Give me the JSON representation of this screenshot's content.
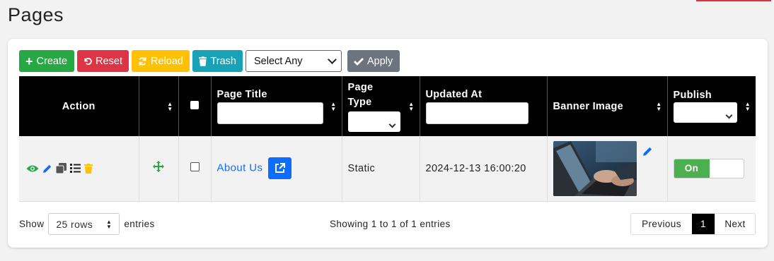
{
  "page": {
    "title": "Pages"
  },
  "toolbar": {
    "create_label": "Create",
    "reset_label": "Reset",
    "reload_label": "Reload",
    "trash_label": "Trash",
    "bulk_select_value": "Select Any",
    "apply_label": "Apply"
  },
  "table": {
    "headers": {
      "action": "Action",
      "page_title": "Page Title",
      "page_type": "Page Type",
      "updated_at": "Updated At",
      "banner_image": "Banner Image",
      "publish": "Publish"
    },
    "rows": [
      {
        "page_title": "About Us",
        "page_type": "Static",
        "updated_at": "2024-12-13 16:00:20",
        "banner_alt": "laptop-typing-photo",
        "publish": "On"
      }
    ]
  },
  "footer": {
    "show_label": "Show",
    "rows_value": "25 rows",
    "entries_label": "entries",
    "showing_text": "Showing 1 to 1 of 1 entries",
    "previous_label": "Previous",
    "current_page": "1",
    "next_label": "Next"
  },
  "colors": {
    "create": "#28a745",
    "reset": "#dc3545",
    "reload": "#ffc107",
    "trash": "#17a2b8",
    "apply": "#6c757d",
    "header_bg": "#000000",
    "link": "#0d6efd",
    "toggle_on": "#4caf50"
  }
}
